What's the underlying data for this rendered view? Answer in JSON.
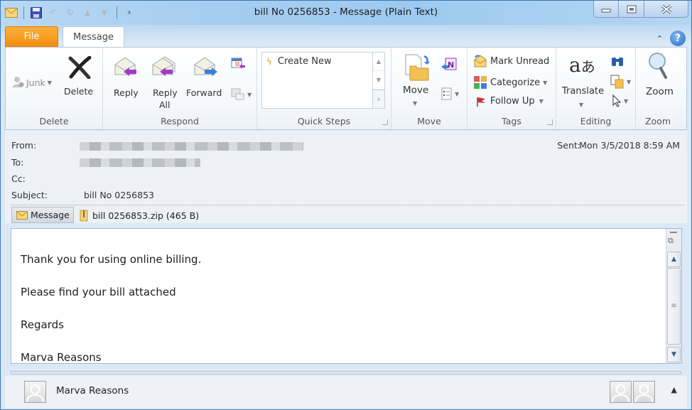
{
  "window": {
    "title": "bill No 0256853  -  Message (Plain Text)",
    "controls": {
      "minimize": "minimize",
      "maximize": "maximize",
      "close": "close"
    }
  },
  "quick_access": {
    "icons": [
      "mail-icon",
      "save-icon",
      "undo-icon",
      "redo-icon",
      "previous-item-icon",
      "next-item-icon",
      "customize-qat-icon"
    ]
  },
  "tabs": {
    "file": "File",
    "message": "Message",
    "active": "Message"
  },
  "ribbon": {
    "groups": {
      "delete": {
        "label": "Delete",
        "junk": "Junk",
        "delete": "Delete"
      },
      "respond": {
        "label": "Respond",
        "reply": "Reply",
        "reply_all_line1": "Reply",
        "reply_all_line2": "All",
        "forward": "Forward"
      },
      "quick_steps": {
        "label": "Quick Steps",
        "items": [
          "Create New"
        ]
      },
      "move": {
        "label": "Move",
        "move": "Move"
      },
      "tags": {
        "label": "Tags",
        "mark_unread": "Mark Unread",
        "categorize": "Categorize",
        "follow_up": "Follow Up"
      },
      "editing": {
        "label": "Editing",
        "translate": "Translate"
      },
      "zoom": {
        "label": "Zoom",
        "zoom": "Zoom"
      }
    }
  },
  "header": {
    "from_label": "From:",
    "to_label": "To:",
    "cc_label": "Cc:",
    "subject_label": "Subject:",
    "subject": "bill No 0256853",
    "sent_label": "Sent:",
    "sent": "Mon 3/5/2018 8:59 AM",
    "from_redacted": true,
    "to_redacted": true
  },
  "attachments": {
    "message_tab": "Message",
    "files": [
      {
        "name": "bill 0256853.zip (465 B)"
      }
    ]
  },
  "body": {
    "lines": [
      "Thank you for using online billing.",
      "Please find your bill attached",
      "Regards",
      "Marva Reasons"
    ]
  },
  "people_pane": {
    "name": "Marva Reasons"
  }
}
